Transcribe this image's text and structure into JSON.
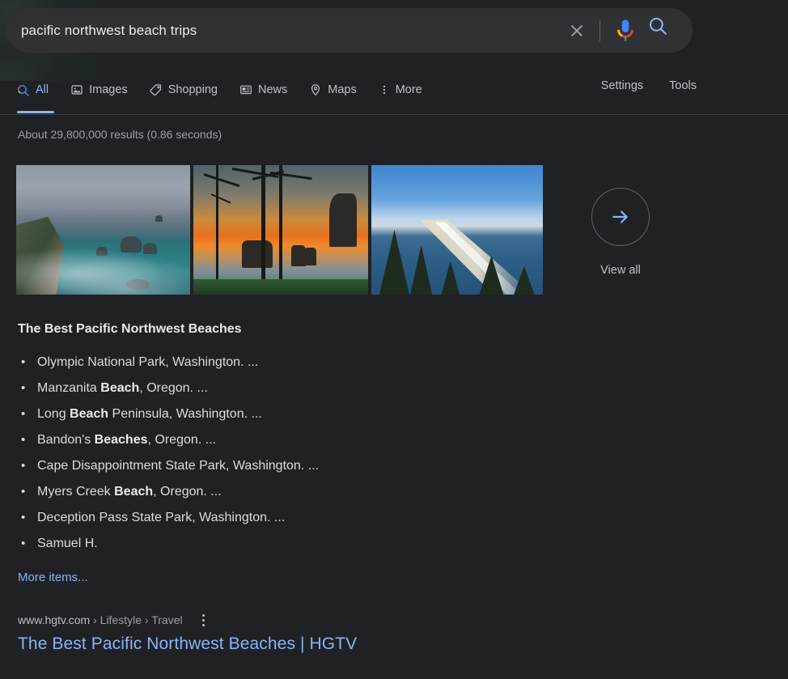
{
  "colors": {
    "page_bg": "#202124",
    "searchbar_bg": "#303134",
    "accent_blue": "#8ab4f8",
    "text_primary": "#e8eaed",
    "text_secondary": "#bdc1c6",
    "text_muted": "#9aa0a6"
  },
  "search": {
    "query": "pacific northwest beach trips",
    "placeholder": "Search",
    "clear_icon": "close-icon",
    "mic_icon": "microphone-icon",
    "search_icon": "search-icon"
  },
  "nav": {
    "tabs": [
      {
        "label": "All",
        "icon": "search-icon",
        "active": true
      },
      {
        "label": "Images",
        "icon": "image-icon",
        "active": false
      },
      {
        "label": "Shopping",
        "icon": "tag-icon",
        "active": false
      },
      {
        "label": "News",
        "icon": "newspaper-icon",
        "active": false
      },
      {
        "label": "Maps",
        "icon": "map-pin-icon",
        "active": false
      },
      {
        "label": "More",
        "icon": "kebab-menu-icon",
        "active": false
      }
    ],
    "settings_label": "Settings",
    "tools_label": "Tools"
  },
  "results": {
    "count_text": "About 29,800,000 results (0.86 seconds)",
    "images": [
      {
        "alt": "Rocky coastline with sea stacks under cloudy sky"
      },
      {
        "alt": "Sunset over beach seen through silhouetted pine trees"
      },
      {
        "alt": "Aerial view of long sandy beach and forested headland"
      }
    ],
    "view_all": {
      "label": "View all",
      "icon": "arrow-right-icon"
    },
    "featured": {
      "heading": "The Best Pacific Northwest Beaches",
      "items": [
        {
          "pre": "Olympic National Park, Washington. ...",
          "bold": "",
          "post": ""
        },
        {
          "pre": "Manzanita ",
          "bold": "Beach",
          "post": ", Oregon. ..."
        },
        {
          "pre": "Long ",
          "bold": "Beach",
          "post": " Peninsula, Washington. ..."
        },
        {
          "pre": "Bandon's ",
          "bold": "Beaches",
          "post": ", Oregon. ..."
        },
        {
          "pre": "Cape Disappointment State Park, Washington. ...",
          "bold": "",
          "post": ""
        },
        {
          "pre": "Myers Creek ",
          "bold": "Beach",
          "post": ", Oregon. ..."
        },
        {
          "pre": "Deception Pass State Park, Washington. ...",
          "bold": "",
          "post": ""
        },
        {
          "pre": "Samuel H.",
          "bold": "",
          "post": ""
        }
      ],
      "more_items_label": "More items..."
    },
    "organic": {
      "domain": "www.hgtv.com",
      "breadcrumb": "› Lifestyle › Travel",
      "menu_icon": "kebab-menu-icon",
      "title": "The Best Pacific Northwest Beaches | HGTV"
    }
  }
}
